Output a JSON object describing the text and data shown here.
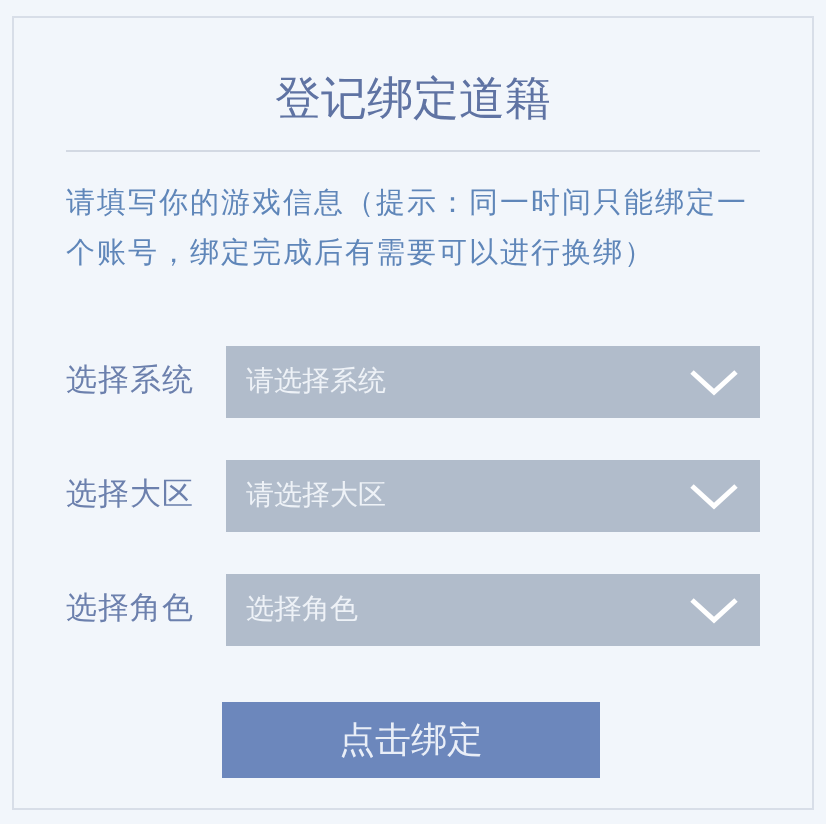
{
  "title": "登记绑定道籍",
  "hint": "请填写你的游戏信息（提示：同一时间只能绑定一个账号，绑定完成后有需要可以进行换绑）",
  "fields": [
    {
      "label": "选择系统",
      "placeholder": "请选择系统"
    },
    {
      "label": "选择大区",
      "placeholder": "请选择大区"
    },
    {
      "label": "选择角色",
      "placeholder": "选择角色"
    }
  ],
  "button": "点击绑定"
}
